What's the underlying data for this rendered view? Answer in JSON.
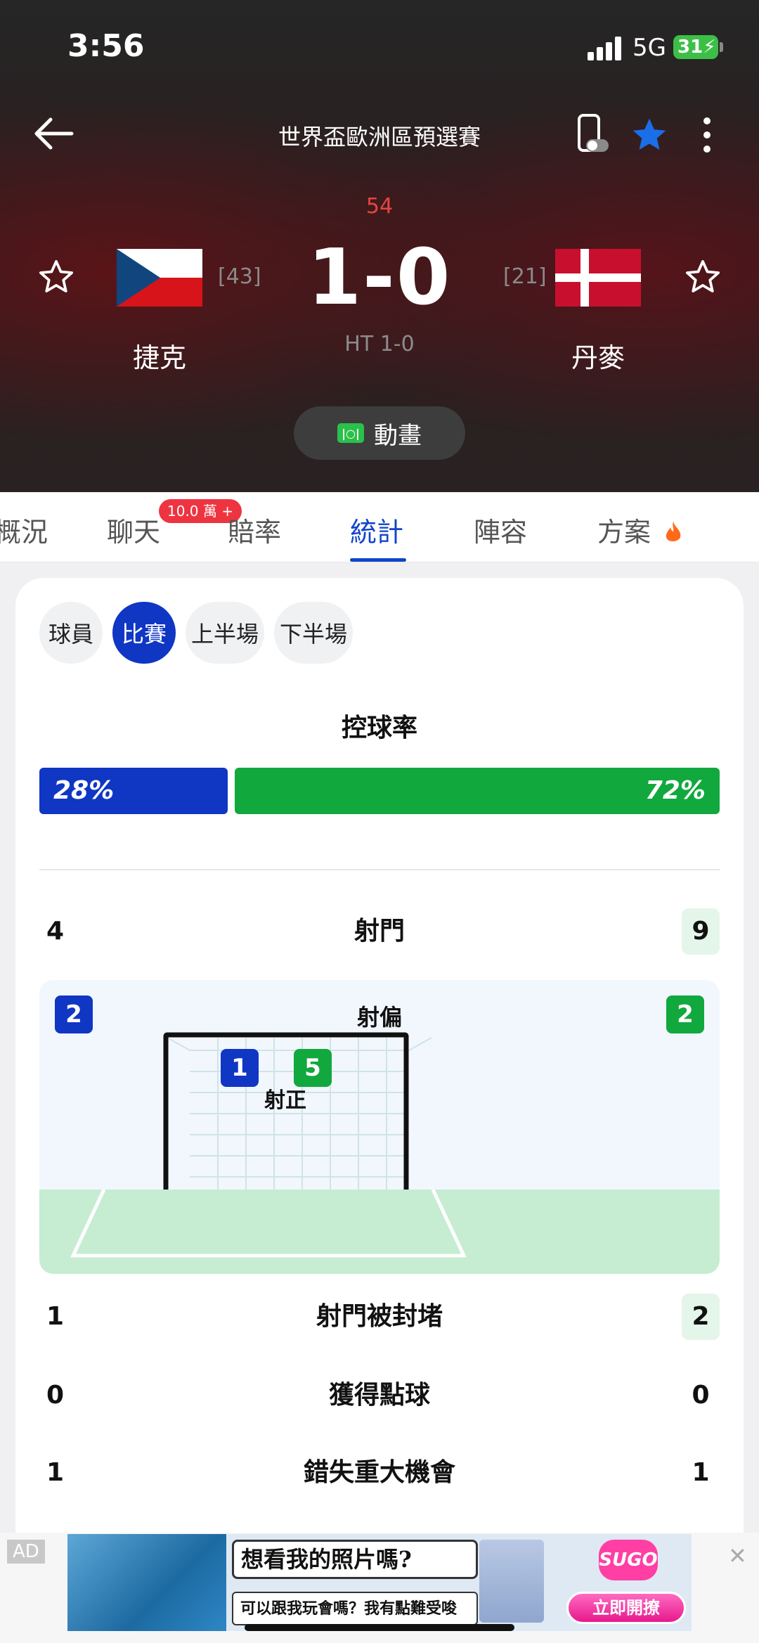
{
  "status_bar": {
    "time": "3:56",
    "network": "5G",
    "battery": "31"
  },
  "header": {
    "competition": "世界盃歐洲區預選賽",
    "minute": "54",
    "score": "1-0",
    "half_time": "HT 1-0",
    "animation_label": "動畫",
    "home": {
      "name": "捷克",
      "rank": "[43]"
    },
    "away": {
      "name": "丹麥",
      "rank": "[21]"
    },
    "favorite_active_color": "#1a6fe8"
  },
  "tabs": {
    "items": [
      "概況",
      "聊天",
      "賠率",
      "統計",
      "陣容",
      "方案"
    ],
    "active": "統計",
    "chat_badge": "10.0 萬 +"
  },
  "filters": {
    "items": [
      "球員",
      "比賽",
      "上半場",
      "下半場"
    ],
    "active": "比賽"
  },
  "stats": {
    "possession": {
      "title": "控球率",
      "home": "28%",
      "away": "72%"
    },
    "shots": {
      "label": "射門",
      "home": "4",
      "away": "9"
    },
    "off_target": {
      "label": "射偏",
      "home": "2",
      "away": "2"
    },
    "on_target": {
      "label": "射正",
      "home": "1",
      "away": "5"
    },
    "blocked": {
      "label": "射門被封堵",
      "home": "1",
      "away": "2"
    },
    "penalties": {
      "label": "獲得點球",
      "home": "0",
      "away": "0"
    },
    "big_chances_missed": {
      "label": "錯失重大機會",
      "home": "1",
      "away": "1"
    }
  },
  "colors": {
    "home": "#1036c4",
    "away": "#11a83e",
    "live_minute": "#e8443f"
  },
  "ad": {
    "tag": "AD",
    "line1": "想看我的照片嗎?",
    "line2": "可以跟我玩會嗎？我有點難受唆",
    "brand": "SUGO",
    "cta": "立即開撩"
  }
}
